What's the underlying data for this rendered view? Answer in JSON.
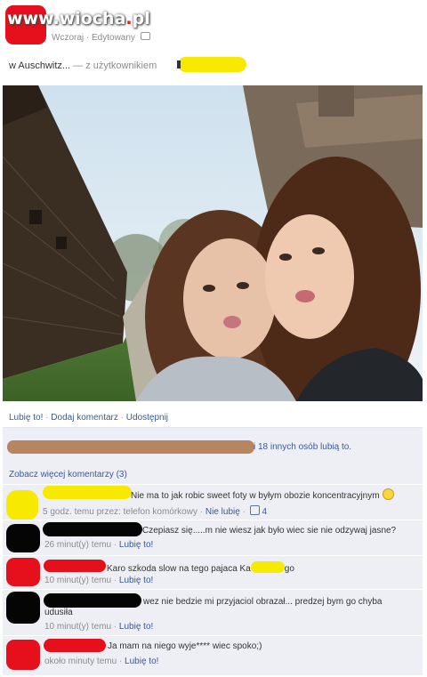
{
  "watermark": {
    "text_pre": "www.",
    "text_brand": "wiocha",
    "text_dot": ".",
    "text_post": "pl"
  },
  "post": {
    "time": "Wczoraj",
    "edited": "Edytowany",
    "location": "w Auschwitz...",
    "with_user": "— z użytkownikiem"
  },
  "actions": {
    "like": "Lubię to!",
    "comment": "Dodaj komentarz",
    "share": "Udostępnij",
    "separator": "·"
  },
  "likes": {
    "text": "i 18 innych osób lubią to."
  },
  "comments_more": "Zobacz więcej komentarzy (3)",
  "comments": [
    {
      "text": "Nie ma to jak robic sweet foty w byłym obozie koncentracyjnym",
      "meta_time": "5 godz. temu przez: telefon komórkowy",
      "meta_unlike": "Nie lubię",
      "meta_likes": "4",
      "avatar_color": "#f7ea00"
    },
    {
      "text": "Czepiasz się.....m nie wiesz jak było wiec sie nie odzywaj jasne?",
      "meta_time": "26 minut(y) temu",
      "meta_like": "Lubię to!",
      "avatar_color": "#050505"
    },
    {
      "text_pre": "Karo szkoda slow na tego pajaca Ka",
      "text_post": "go",
      "meta_time": "10 minut(y) temu",
      "meta_like": "Lubię to!",
      "avatar_color": "#e5101b"
    },
    {
      "text": "wez nie bedzie mi przyjaciol obrazał... predzej bym go chyba",
      "text2": "udusiła",
      "meta_time": "10 minut(y) temu",
      "meta_like": "Lubię to!",
      "avatar_color": "#050505"
    },
    {
      "text": "Ja mam na niego wyje**** wiec spoko;)",
      "meta_time": "około minuty temu",
      "meta_like": "Lubię to!",
      "avatar_color": "#e5101b"
    }
  ]
}
